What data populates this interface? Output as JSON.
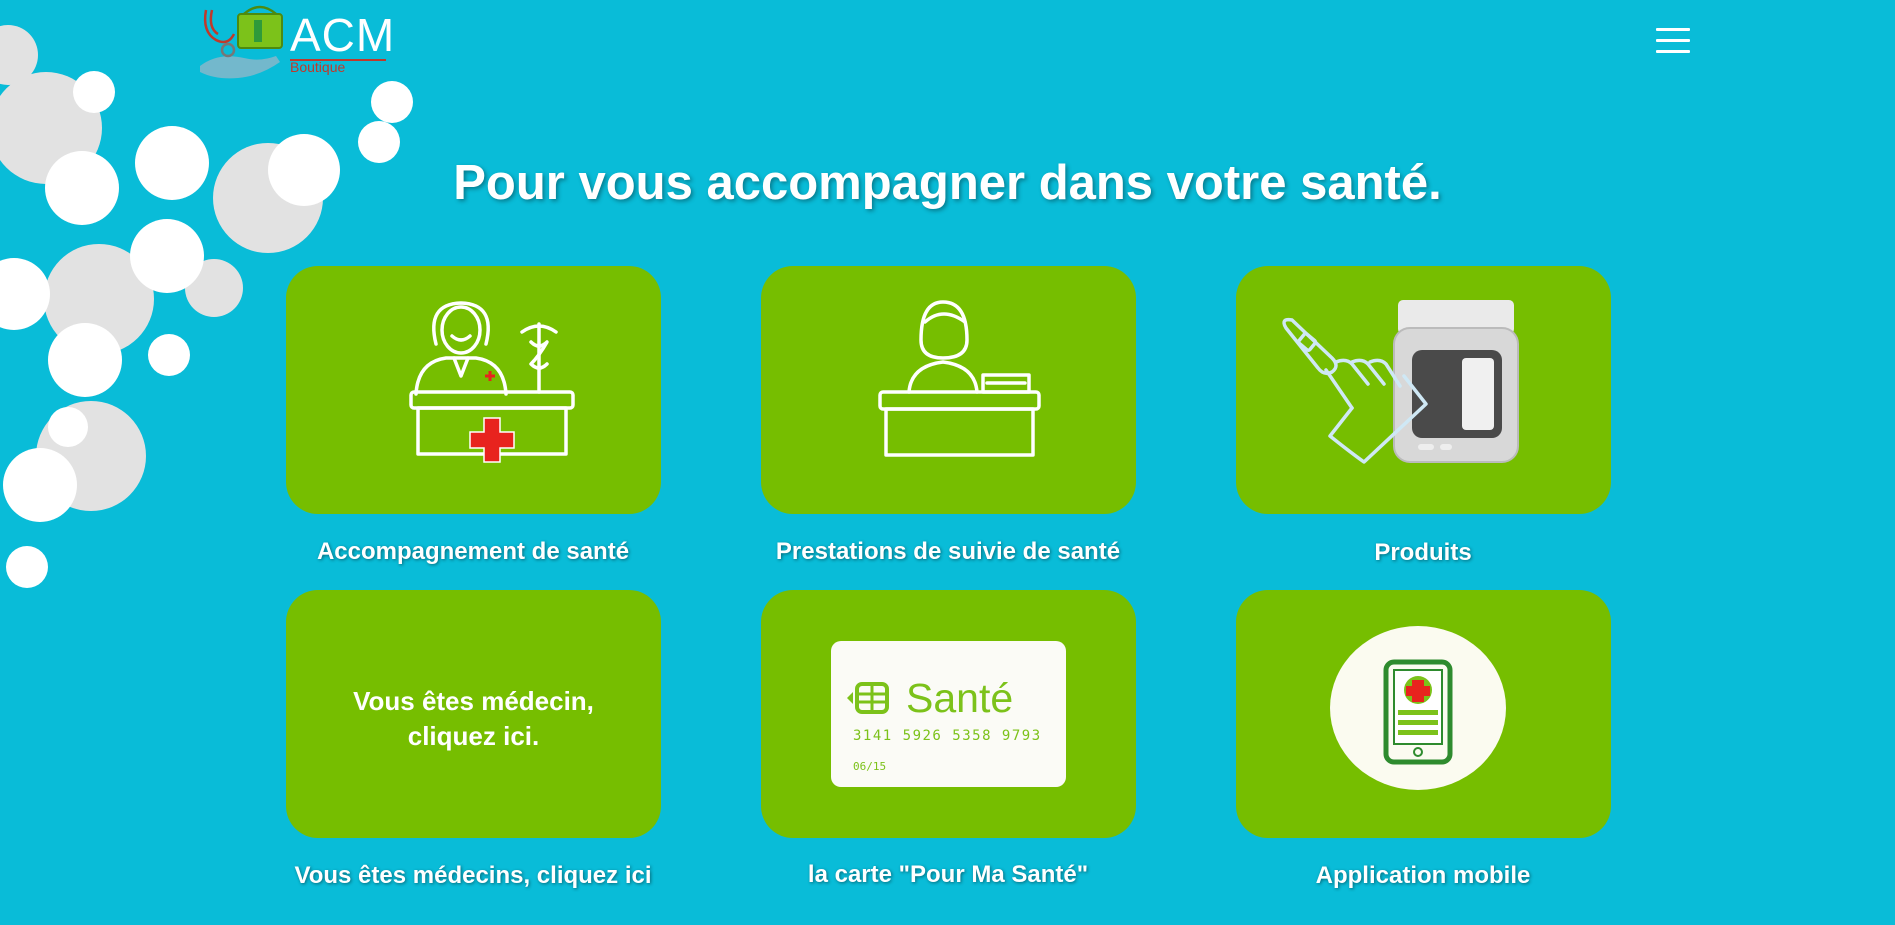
{
  "logo": {
    "title": "ACM",
    "subtitle": "Boutique"
  },
  "nav": {
    "menu_icon": "hamburger-menu-icon"
  },
  "headline": "Pour vous accompagner dans votre santé.",
  "cards": [
    {
      "caption": "Accompagnement de santé",
      "icon": "pharmacist-at-counter-icon"
    },
    {
      "caption": "Prestations de suivie de santé",
      "icon": "receptionist-at-desk-icon"
    },
    {
      "caption": "Produits",
      "icon": "oximeter-and-medicine-bottle-icon"
    },
    {
      "caption": "Vous êtes médecins, cliquez ici",
      "card_text": "Vous êtes médecin,\ncliquez ici.",
      "icon": ""
    },
    {
      "caption": "la carte \"Pour Ma Santé\"",
      "icon": "health-card-icon",
      "card": {
        "title": "Santé",
        "number": "3141 5926 5358 9793",
        "expiry": "06/15"
      }
    },
    {
      "caption": "Application mobile",
      "icon": "mobile-phone-medical-icon"
    }
  ],
  "colors": {
    "background": "#09bcd8",
    "card": "#76be00",
    "accent_red": "#e8231e",
    "text": "#ffffff"
  }
}
